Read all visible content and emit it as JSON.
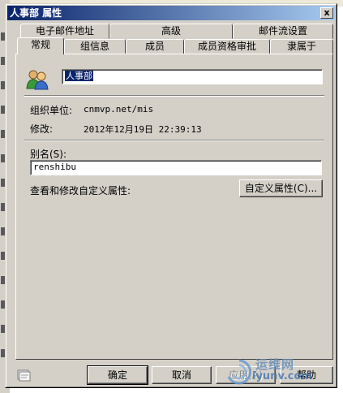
{
  "dialog": {
    "title": "人事部 属性",
    "close_label": "x"
  },
  "tabs": {
    "row1": [
      {
        "label": "电子邮件地址"
      },
      {
        "label": "高级"
      },
      {
        "label": "邮件流设置"
      }
    ],
    "row2": [
      {
        "label": "常规",
        "active": true
      },
      {
        "label": "组信息"
      },
      {
        "label": "成员"
      },
      {
        "label": "成员资格审批"
      },
      {
        "label": "隶属于"
      }
    ]
  },
  "general": {
    "name_value": "人事部",
    "ou_label": "组织单位:",
    "ou_value": "cnmvp.net/mis",
    "modified_label": "修改:",
    "modified_value": "2012年12月19日 22:39:13",
    "alias_label": "别名(S):",
    "alias_value": "renshibu",
    "custom_attr_label": "查看和修改自定义属性:",
    "custom_attr_button": "自定义属性(C)..."
  },
  "buttons": {
    "ok": "确定",
    "cancel": "取消",
    "apply": "应用(A)",
    "help": "帮助"
  },
  "watermark": {
    "text": "运维网",
    "url": "iyunv.com"
  },
  "colors": {
    "titlebar_start": "#0a246a",
    "titlebar_end": "#a6caf0",
    "face": "#d4d0c8",
    "selection": "#0a246a"
  }
}
